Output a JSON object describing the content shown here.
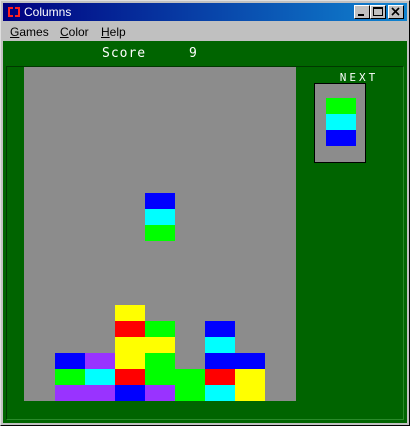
{
  "window": {
    "title": "Columns"
  },
  "titlebar_buttons": [
    {
      "name": "minimize-button",
      "icon": "minimize-icon"
    },
    {
      "name": "maximize-button",
      "icon": "maximize-icon"
    },
    {
      "name": "close-button",
      "icon": "close-icon"
    }
  ],
  "menu": [
    {
      "label": "Games",
      "mnemonic": "G"
    },
    {
      "label": "Color",
      "mnemonic": "C"
    },
    {
      "label": "Help",
      "mnemonic": "H"
    }
  ],
  "score": {
    "label": "Score",
    "value": "9"
  },
  "next": {
    "label": "NEXT",
    "piece": [
      "green",
      "cyan",
      "blue"
    ]
  },
  "colors": {
    "board_bg": "#8c8c8c",
    "game_bg": "#006400",
    "blue": "#0000ff",
    "cyan": "#00ffff",
    "green": "#00ff00",
    "red": "#ff0000",
    "yellow": "#ffff00",
    "purple": "#9933ff"
  },
  "board": {
    "columns": 9,
    "falling_piece": {
      "column": 4,
      "top_row": 7,
      "cells": [
        "blue",
        "cyan",
        "green"
      ]
    },
    "stacks": [
      {
        "column": 1,
        "cells": [
          "blue",
          "green",
          "purple"
        ]
      },
      {
        "column": 2,
        "cells": [
          "purple",
          "cyan",
          "purple"
        ]
      },
      {
        "column": 3,
        "cells": [
          "yellow",
          "red",
          "yellow",
          "yellow",
          "red",
          "blue"
        ]
      },
      {
        "column": 4,
        "cells": [
          "green",
          "yellow",
          "green",
          "green",
          "purple"
        ]
      },
      {
        "column": 5,
        "cells": [
          "green",
          "green"
        ]
      },
      {
        "column": 6,
        "cells": [
          "blue",
          "cyan",
          "blue",
          "red",
          "cyan"
        ]
      },
      {
        "column": 7,
        "cells": [
          "blue",
          "yellow",
          "yellow"
        ]
      }
    ]
  }
}
